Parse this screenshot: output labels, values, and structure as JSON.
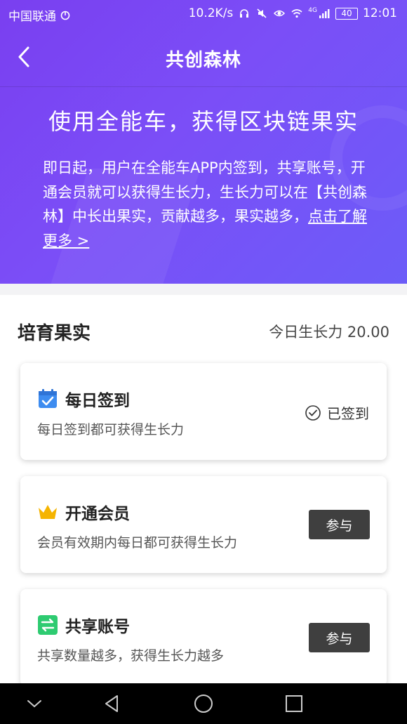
{
  "status_bar": {
    "carrier": "中国联通",
    "network_speed": "10.2K/s",
    "signal_label": "4G",
    "battery": "40",
    "time": "12:01"
  },
  "nav": {
    "title": "共创森林"
  },
  "hero": {
    "title": "使用全能车，获得区块链果实",
    "description": "即日起，用户在全能车APP内签到，共享账号，开通会员就可以获得生长力，生长力可以在【共创森林】中长出果实，贡献越多，果实越多，",
    "link_text": "点击了解更多 >"
  },
  "section": {
    "title": "培育果实",
    "growth_text": "今日生长力 20.00"
  },
  "tasks": [
    {
      "name": "每日签到",
      "desc": "每日签到都可获得生长力",
      "status": "已签到",
      "icon": "calendar-check-icon",
      "icon_color": "#3d8cf0"
    },
    {
      "name": "开通会员",
      "desc": "会员有效期内每日都可获得生长力",
      "button": "参与",
      "icon": "crown-icon",
      "icon_color": "#f5b400"
    },
    {
      "name": "共享账号",
      "desc": "共享数量越多，获得生长力越多",
      "button": "参与",
      "icon": "swap-arrows-icon",
      "icon_color": "#2ecb71"
    }
  ],
  "colors": {
    "accent": "#7a3ff0",
    "button": "#3f3f3f"
  }
}
